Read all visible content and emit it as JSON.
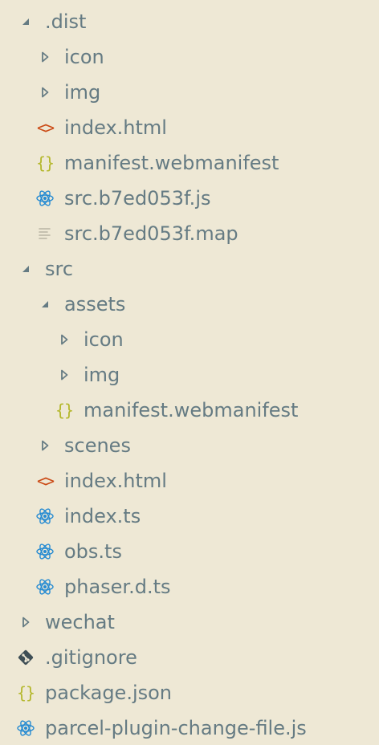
{
  "explorer": {
    "items": [
      {
        "label": ".dist",
        "icon": "chevron-down-icon"
      },
      {
        "label": "icon",
        "icon": "chevron-right-icon"
      },
      {
        "label": "img",
        "icon": "chevron-right-icon"
      },
      {
        "label": "index.html",
        "icon": "html-file-icon"
      },
      {
        "label": "manifest.webmanifest",
        "icon": "json-file-icon"
      },
      {
        "label": "src.b7ed053f.js",
        "icon": "react-file-icon"
      },
      {
        "label": "src.b7ed053f.map",
        "icon": "text-file-icon"
      },
      {
        "label": "src",
        "icon": "chevron-down-icon"
      },
      {
        "label": "assets",
        "icon": "chevron-down-icon"
      },
      {
        "label": "icon",
        "icon": "chevron-right-icon"
      },
      {
        "label": "img",
        "icon": "chevron-right-icon"
      },
      {
        "label": "manifest.webmanifest",
        "icon": "json-file-icon"
      },
      {
        "label": "scenes",
        "icon": "chevron-right-icon"
      },
      {
        "label": "index.html",
        "icon": "html-file-icon"
      },
      {
        "label": "index.ts",
        "icon": "react-file-icon"
      },
      {
        "label": "obs.ts",
        "icon": "react-file-icon"
      },
      {
        "label": "phaser.d.ts",
        "icon": "react-file-icon"
      },
      {
        "label": "wechat",
        "icon": "chevron-right-icon"
      },
      {
        "label": ".gitignore",
        "icon": "git-icon"
      },
      {
        "label": "package.json",
        "icon": "json-file-icon"
      },
      {
        "label": "parcel-plugin-change-file.js",
        "icon": "react-file-icon"
      }
    ]
  },
  "colors": {
    "background": "#eee8d5",
    "text": "#657b83",
    "chevron": "#657b83",
    "html_icon": "#cb4b16",
    "json_icon": "#b5b82e",
    "react_icon": "#268bd2",
    "text_icon": "#b9b4a3",
    "git_icon": "#3f4f56"
  }
}
